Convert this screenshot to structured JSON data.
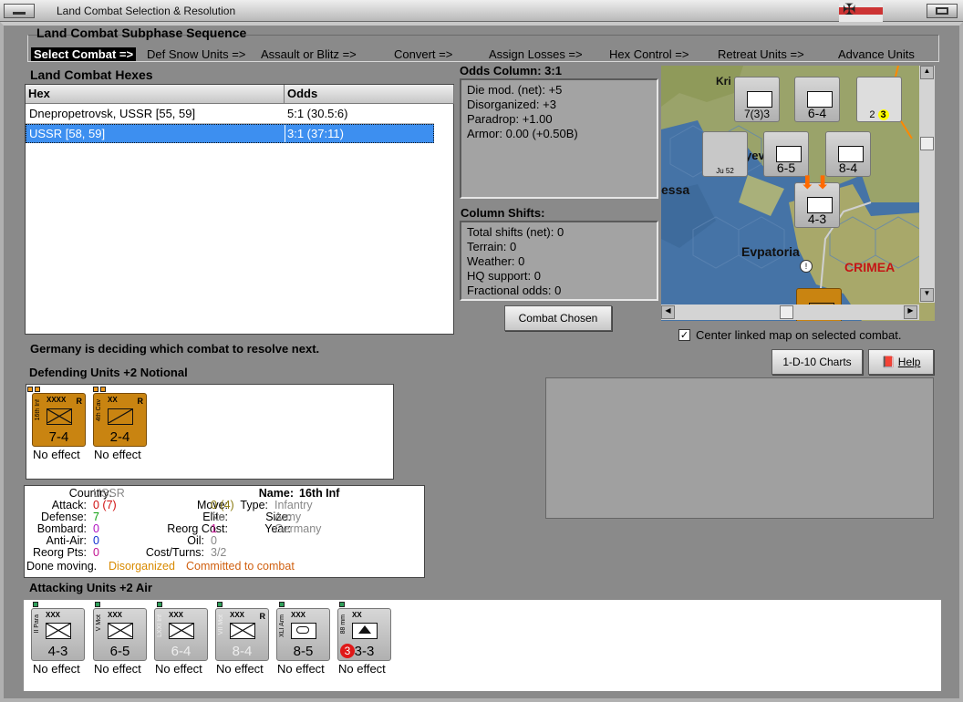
{
  "window": {
    "title": "Land Combat Selection & Resolution"
  },
  "subphase": {
    "title": "Land Combat Subphase Sequence",
    "steps": [
      "Select Combat =>",
      "Def Snow Units =>",
      "Assault or Blitz =>",
      "Convert =>",
      "Assign Losses =>",
      "Hex Control =>",
      "Retreat Units =>",
      "Advance Units"
    ]
  },
  "hexes": {
    "title": "Land Combat Hexes",
    "columns": [
      "Hex",
      "Odds"
    ],
    "rows": [
      {
        "hex": "Dnepropetrovsk, USSR [55, 59]",
        "odds": "5:1 (30.5:6)"
      },
      {
        "hex": "USSR [58, 59]",
        "odds": "3:1 (37:11)"
      }
    ]
  },
  "odds": {
    "title": "Odds Column: 3:1",
    "lines": [
      "Die mod. (net): +5",
      "Disorganized: +3",
      "Paradrop: +1.00",
      "Armor: 0.00 (+0.50B)"
    ]
  },
  "shifts": {
    "title": "Column Shifts:",
    "lines": [
      "Total shifts (net): 0",
      "Terrain: 0",
      "Weather: 0",
      "HQ support: 0",
      "Fractional odds: 0"
    ]
  },
  "buttons": {
    "combat_chosen": "Combat Chosen",
    "charts": "1-D-10 Charts",
    "help": "Help"
  },
  "center_map": {
    "label": "Center linked map on selected combat.",
    "checked": true
  },
  "status": "Germany is deciding which combat to resolve next.",
  "map": {
    "labels": [
      "Evpatoria",
      "CRIMEA",
      "essa",
      "Kri",
      "yev"
    ]
  },
  "defending": {
    "title": "Defending Units +2 Notional",
    "units": [
      {
        "name": "16th Inf",
        "size": "XXXX",
        "value": "7-4",
        "reserve": "R",
        "result": "No effect",
        "type": "inf"
      },
      {
        "name": "4th Cav",
        "size": "XX",
        "value": "2-4",
        "reserve": "R",
        "result": "No effect",
        "type": "cav"
      }
    ]
  },
  "detail": {
    "country_label": "Country:",
    "country": "USSR",
    "attack_label": "Attack:",
    "attack": "0 (7)",
    "defense_label": "Defense:",
    "defense": "7",
    "bombard_label": "Bombard:",
    "bombard": "0",
    "antiair_label": "Anti-Air:",
    "antiair": "0",
    "reorgpts_label": "Reorg Pts:",
    "reorgpts": "0",
    "move_label": "Move:",
    "move": "0 (4)",
    "elite_label": "Elite:",
    "elite": "No",
    "reorgcost_label": "Reorg Cost:",
    "reorgcost": "1",
    "oil_label": "Oil:",
    "oil": "0",
    "costturns_label": "Cost/Turns:",
    "costturns": "3/2",
    "name_label": "Name:",
    "name": "16th Inf",
    "type_label": "Type:",
    "type": "Infantry",
    "size_label": "Size:",
    "size": "Army",
    "year_label": "Year:",
    "year": "Germany",
    "done": "Done moving.",
    "disorg": "Disorganized",
    "committed": "Committed to combat"
  },
  "attacking": {
    "title": "Attacking Units +2 Air",
    "units": [
      {
        "name": "II Para",
        "size": "XXX",
        "value": "4-3",
        "result": "No effect",
        "type": "para"
      },
      {
        "name": "V Mot",
        "size": "XXX",
        "value": "6-5",
        "result": "No effect",
        "type": "mot"
      },
      {
        "name": "LXXI Inf",
        "size": "XXX",
        "value": "6-4",
        "result": "No effect",
        "type": "inf"
      },
      {
        "name": "VII Mot",
        "size": "XXX",
        "value": "8-4",
        "reserve": "R",
        "result": "No effect",
        "type": "mot"
      },
      {
        "name": "XLI Arm",
        "size": "XXX",
        "value": "8-5",
        "result": "No effect",
        "type": "arm"
      },
      {
        "name": "88 mm",
        "size": "XX",
        "value": "3-3",
        "badge": "3",
        "result": "No effect",
        "type": "art"
      }
    ]
  }
}
